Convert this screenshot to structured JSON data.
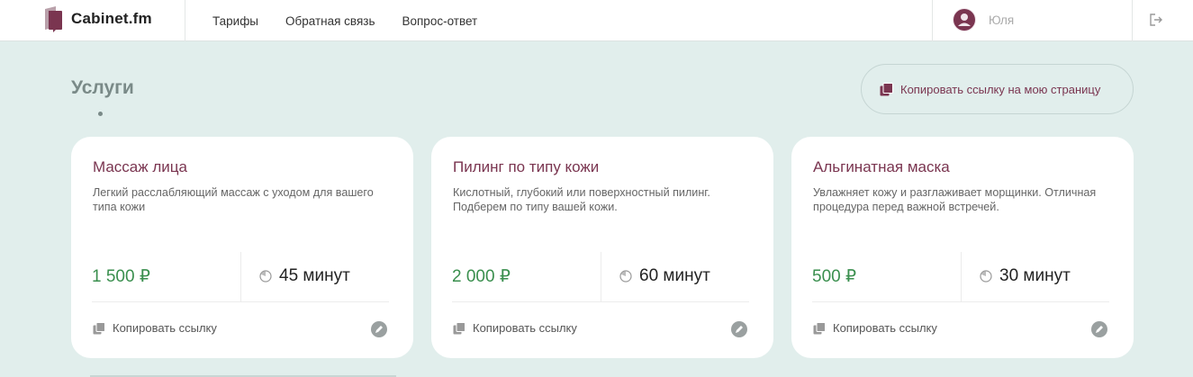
{
  "header": {
    "brand": "Cabinet.fm",
    "nav": [
      "Тарифы",
      "Обратная связь",
      "Вопрос-ответ"
    ],
    "user_name": "Юля"
  },
  "page": {
    "title": "Услуги",
    "copy_page_label": "Копировать ссылку на мою страницу"
  },
  "services": [
    {
      "title": "Массаж лица",
      "description": "Легкий расслабляющий массаж с уходом для вашего типа кожи",
      "price": "1 500 ₽",
      "duration": "45 минут",
      "copy_label": "Копировать ссылку"
    },
    {
      "title": "Пилинг по типу кожи",
      "description": "Кислотный, глубокий или поверхностный пилинг. Подберем по типу вашей кожи.",
      "price": "2 000 ₽",
      "duration": "60 минут",
      "copy_label": "Копировать ссылку"
    },
    {
      "title": "Альгинатная маска",
      "description": "Увлажняет кожу и разглаживает морщинки. Отличная процедура перед важной встречей.",
      "price": "500 ₽",
      "duration": "30 минут",
      "copy_label": "Копировать ссылку"
    }
  ],
  "colors": {
    "accent": "#7a3550",
    "price": "#3a8f4e",
    "background": "#e1eeec"
  }
}
